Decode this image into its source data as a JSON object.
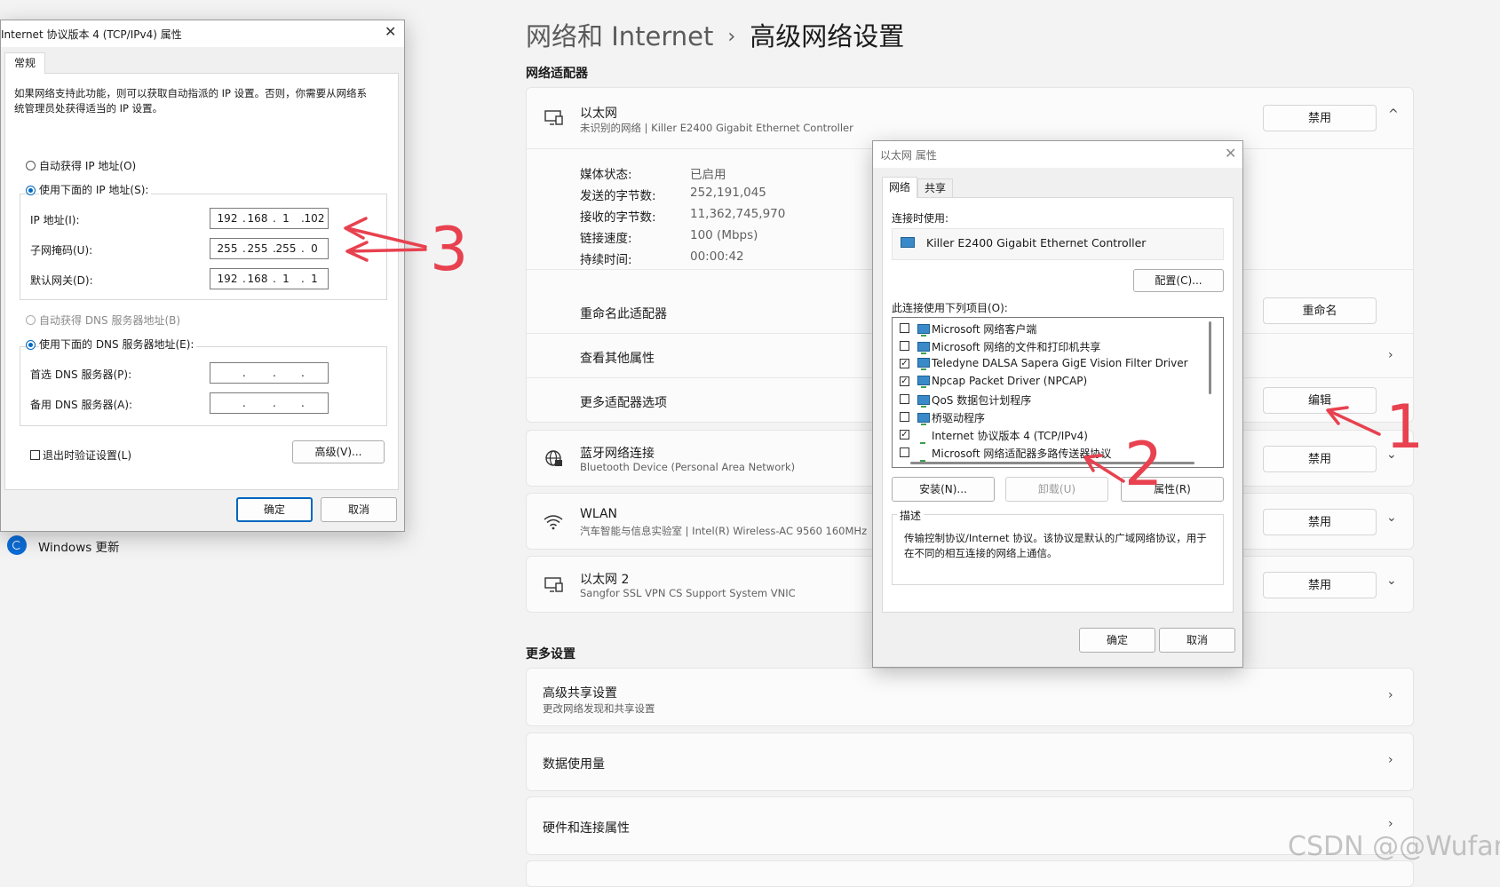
{
  "settings": {
    "breadcrumb_parent": "网络和 Internet",
    "breadcrumb_separator": "›",
    "breadcrumb_current": "高级网络设置",
    "section_adapters": "网络适配器",
    "ethernet": {
      "name": "以太网",
      "desc": "未识别的网络 | Killer E2400 Gigabit Ethernet Controller",
      "disable_label": "禁用",
      "expand_chevron": "^",
      "props": [
        {
          "label": "媒体状态:",
          "value": "已启用"
        },
        {
          "label": "发送的字节数:",
          "value": "252,191,045"
        },
        {
          "label": "接收的字节数:",
          "value": "11,362,745,970"
        },
        {
          "label": "链接速度:",
          "value": "100 (Mbps)"
        },
        {
          "label": "持续时间:",
          "value": "00:00:42"
        }
      ],
      "rename_text": "重命名此适配器",
      "rename_button": "重命名",
      "view_more": "查看其他属性",
      "more_options": "更多适配器选项",
      "edit_button": "编辑"
    },
    "bluetooth": {
      "name": "蓝牙网络连接",
      "desc": "Bluetooth Device (Personal Area Network)",
      "disable_label": "禁用"
    },
    "wlan": {
      "name": "WLAN",
      "desc": "汽车智能与信息实验室 | Intel(R) Wireless-AC 9560 160MHz",
      "disable_label": "禁用"
    },
    "ethernet2": {
      "name": "以太网 2",
      "desc": "Sangfor SSL VPN CS Support System VNIC",
      "disable_label": "禁用"
    },
    "section_more": "更多设置",
    "more": [
      {
        "title": "高级共享设置",
        "subtitle": "更改网络发现和共享设置"
      },
      {
        "title": "数据使用量",
        "subtitle": ""
      },
      {
        "title": "硬件和连接属性",
        "subtitle": ""
      }
    ],
    "windows_update": "Windows 更新"
  },
  "ipv4_dialog": {
    "title": "Internet 协议版本 4 (TCP/IPv4) 属性",
    "tab": "常规",
    "description": "如果网络支持此功能，则可以获取自动指派的 IP 设置。否则，你需要从网络系统管理员处获得适当的 IP 设置。",
    "auto_ip": "自动获得 IP 地址(O)",
    "use_ip": "使用下面的 IP 地址(S):",
    "ip_label": "IP 地址(I):",
    "mask_label": "子网掩码(U):",
    "gateway_label": "默认网关(D):",
    "ip": [
      "192",
      "168",
      "1",
      "102"
    ],
    "mask": [
      "255",
      "255",
      "255",
      "0"
    ],
    "gateway": [
      "192",
      "168",
      "1",
      "1"
    ],
    "auto_dns": "自动获得 DNS 服务器地址(B)",
    "use_dns": "使用下面的 DNS 服务器地址(E):",
    "dns1_label": "首选 DNS 服务器(P):",
    "dns2_label": "备用 DNS 服务器(A):",
    "validate": "退出时验证设置(L)",
    "advanced": "高级(V)...",
    "ok": "确定",
    "cancel": "取消"
  },
  "eth_props_dialog": {
    "title": "以太网 属性",
    "tabs": [
      "网络",
      "共享"
    ],
    "connect_using_label": "连接时使用:",
    "adapter": "Killer E2400 Gigabit Ethernet Controller",
    "configure": "配置(C)...",
    "items_label": "此连接使用下列项目(O):",
    "items": [
      {
        "label": "Microsoft 网络客户端",
        "checked": false
      },
      {
        "label": "Microsoft 网络的文件和打印机共享",
        "checked": false
      },
      {
        "label": "Teledyne DALSA Sapera GigE Vision Filter Driver",
        "checked": true
      },
      {
        "label": "Npcap Packet Driver (NPCAP)",
        "checked": true
      },
      {
        "label": "QoS 数据包计划程序",
        "checked": false
      },
      {
        "label": "桥驱动程序",
        "checked": false
      },
      {
        "label": "Internet 协议版本 4 (TCP/IPv4)",
        "checked": true
      },
      {
        "label": "Microsoft 网络适配器多路传送器协议",
        "checked": false
      }
    ],
    "install": "安装(N)...",
    "uninstall": "卸载(U)",
    "properties": "属性(R)",
    "desc_label": "描述",
    "desc_text": "传输控制协议/Internet 协议。该协议是默认的广域网络协议，用于在不同的相互连接的网络上通信。",
    "ok": "确定",
    "cancel": "取消"
  },
  "annotations": {
    "n1": "1",
    "n2": "2",
    "n3": "3",
    "color": "#e8414f"
  },
  "watermark": "CSDN @@Wufan"
}
